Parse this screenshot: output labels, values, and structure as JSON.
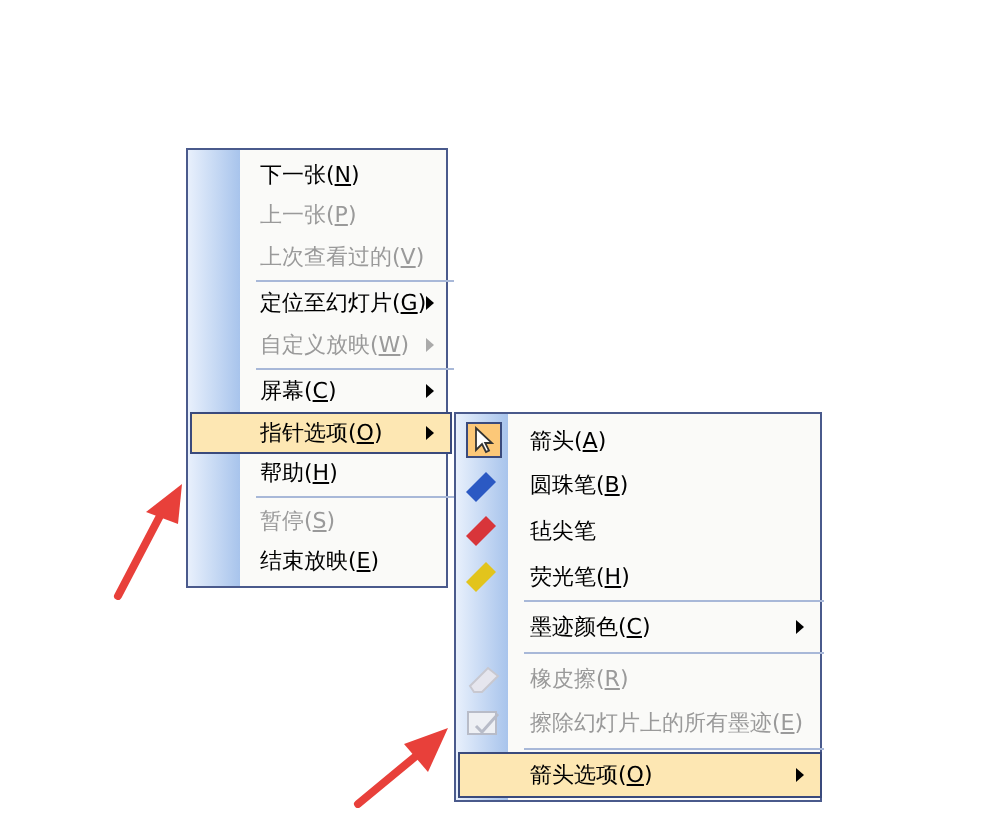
{
  "context_menu": {
    "items": [
      {
        "kind": "item",
        "text": "下一张(",
        "accel": "N",
        "after": ")",
        "disabled": false,
        "selected": false,
        "submenu": false
      },
      {
        "kind": "item",
        "text": "上一张(",
        "accel": "P",
        "after": ")",
        "disabled": true,
        "selected": false,
        "submenu": false
      },
      {
        "kind": "item",
        "text": "上次查看过的(",
        "accel": "V",
        "after": ")",
        "disabled": true,
        "selected": false,
        "submenu": false
      },
      {
        "kind": "separator"
      },
      {
        "kind": "item",
        "text": "定位至幻灯片(",
        "accel": "G",
        "after": ")",
        "disabled": false,
        "selected": false,
        "submenu": true
      },
      {
        "kind": "item",
        "text": "自定义放映(",
        "accel": "W",
        "after": ")",
        "disabled": true,
        "selected": false,
        "submenu": true
      },
      {
        "kind": "separator"
      },
      {
        "kind": "item",
        "text": "屏幕(",
        "accel": "C",
        "after": ")",
        "disabled": false,
        "selected": false,
        "submenu": true
      },
      {
        "kind": "item",
        "text": "指针选项(",
        "accel": "O",
        "after": ")",
        "disabled": false,
        "selected": true,
        "submenu": true
      },
      {
        "kind": "item",
        "text": "帮助(",
        "accel": "H",
        "after": ")",
        "disabled": false,
        "selected": false,
        "submenu": false
      },
      {
        "kind": "separator"
      },
      {
        "kind": "item",
        "text": "暂停(",
        "accel": "S",
        "after": ")",
        "disabled": true,
        "selected": false,
        "submenu": false
      },
      {
        "kind": "item",
        "text": "结束放映(",
        "accel": "E",
        "after": ")",
        "disabled": false,
        "selected": false,
        "submenu": false
      }
    ]
  },
  "pointer_submenu": {
    "items": [
      {
        "kind": "pointer",
        "text": "箭头(",
        "accel": "A",
        "after": ")",
        "checked": true,
        "disabled": false,
        "selected": false,
        "submenu": false
      },
      {
        "kind": "pen",
        "color": "#2b59c3",
        "text": "圆珠笔(",
        "accel": "B",
        "after": ")",
        "disabled": false,
        "selected": false,
        "submenu": false
      },
      {
        "kind": "pen",
        "color": "#d8353a",
        "text": "毡尖笔",
        "disabled": false,
        "selected": false,
        "submenu": false
      },
      {
        "kind": "pen",
        "color": "#e2c41c",
        "text": "荧光笔(",
        "accel": "H",
        "after": ")",
        "disabled": false,
        "selected": false,
        "submenu": false
      },
      {
        "kind": "separator"
      },
      {
        "kind": "item",
        "text": "墨迹颜色(",
        "accel": "C",
        "after": ")",
        "disabled": false,
        "selected": false,
        "submenu": true
      },
      {
        "kind": "separator"
      },
      {
        "kind": "eraser",
        "text": "橡皮擦(",
        "accel": "R",
        "after": ")",
        "disabled": true,
        "selected": false,
        "submenu": false
      },
      {
        "kind": "clear",
        "text": "擦除幻灯片上的所有墨迹(",
        "accel": "E",
        "after": ")",
        "disabled": true,
        "selected": false,
        "submenu": false
      },
      {
        "kind": "separator"
      },
      {
        "kind": "item",
        "text": "箭头选项(",
        "accel": "O",
        "after": ")",
        "disabled": false,
        "selected": true,
        "submenu": true
      }
    ]
  }
}
